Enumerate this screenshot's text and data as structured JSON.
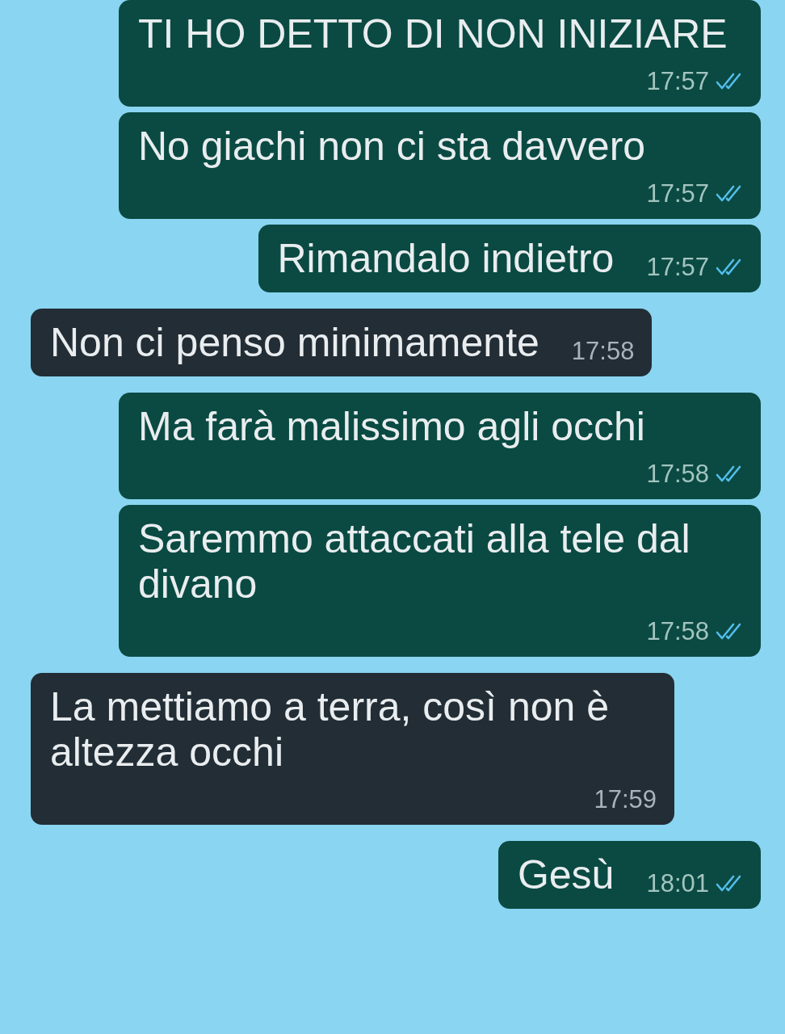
{
  "messages": [
    {
      "kind": "sent",
      "text": "TI HO DETTO DI NON INIZIARE",
      "time": "17:57",
      "read": true
    },
    {
      "kind": "sent",
      "text": "No giachi non ci sta davvero",
      "time": "17:57",
      "read": true
    },
    {
      "kind": "sent",
      "text": "Rimandalo indietro",
      "time": "17:57",
      "read": true
    },
    {
      "kind": "received",
      "text": "Non ci penso minimamente",
      "time": "17:58"
    },
    {
      "kind": "sent",
      "text": "Ma farà malissimo agli occhi",
      "time": "17:58",
      "read": true
    },
    {
      "kind": "sent",
      "text": "Saremmo attaccati alla tele dal divano",
      "time": "17:58",
      "read": true
    },
    {
      "kind": "received",
      "text": "La mettiamo a terra, così non è altezza occhi",
      "time": "17:59"
    },
    {
      "kind": "sent",
      "text": "Gesù",
      "time": "18:01",
      "read": true
    }
  ]
}
